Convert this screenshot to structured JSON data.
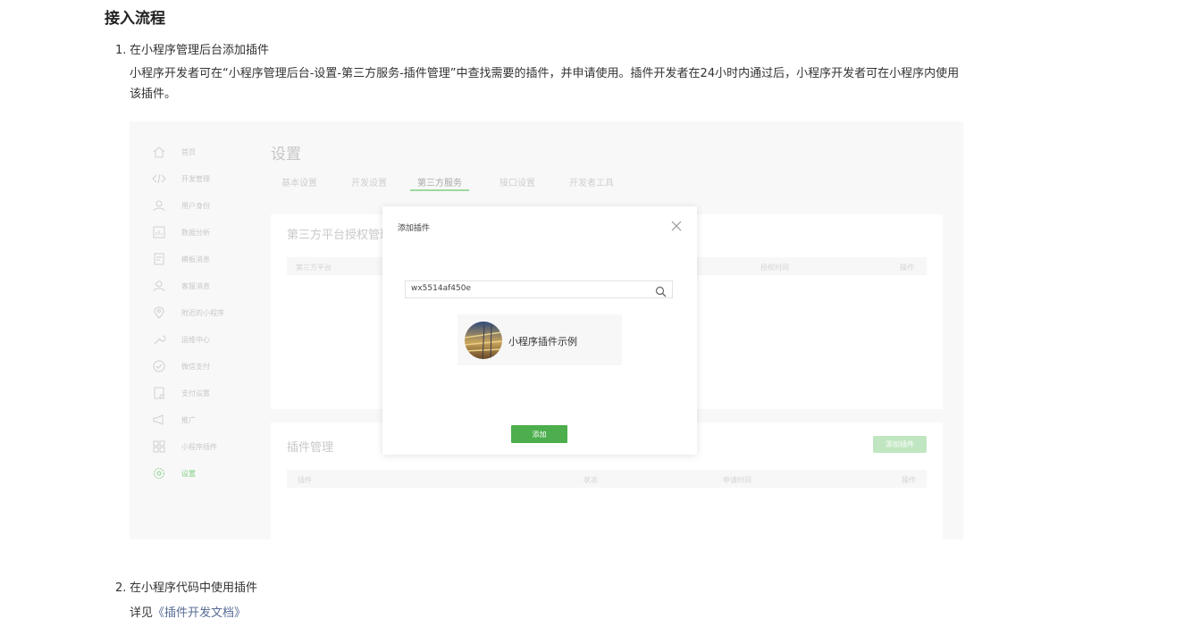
{
  "page": {
    "heading": "接入流程",
    "step1": {
      "number": "1.",
      "title": "在小程序管理后台添加插件"
    },
    "description": "小程序开发者可在“小程序管理后台-设置-第三方服务-插件管理”中查找需要的插件，并申请使用。插件开发者在24小时内通过后，小程序开发者可在小程序内使用该插件。",
    "step2": {
      "number": "2.",
      "title": "在小程序代码中使用插件"
    },
    "see_also": {
      "prefix": "详见",
      "link_text": "《插件开发文档》"
    },
    "link_color": "#576b95"
  },
  "screenshot": {
    "sidebar": [
      {
        "label": "首页",
        "icon": "home-icon"
      },
      {
        "label": "开发管理",
        "icon": "code-icon"
      },
      {
        "label": "用户身份",
        "icon": "user-icon"
      },
      {
        "label": "数据分析",
        "icon": "chart-icon"
      },
      {
        "label": "模板消息",
        "icon": "document-icon"
      },
      {
        "label": "客服消息",
        "icon": "support-icon"
      },
      {
        "label": "附近的小程序",
        "icon": "location-icon"
      },
      {
        "label": "运维中心",
        "icon": "wrench-icon"
      },
      {
        "label": "微信支付",
        "icon": "payment-icon"
      },
      {
        "label": "支付设置",
        "icon": "receipt-icon"
      },
      {
        "label": "推广",
        "icon": "megaphone-icon"
      },
      {
        "label": "小程序插件",
        "icon": "grid-icon"
      },
      {
        "label": "设置",
        "icon": "settings-icon",
        "active": true
      }
    ],
    "title": "设置",
    "tabs": [
      {
        "label": "基本设置"
      },
      {
        "label": "开发设置"
      },
      {
        "label": "第三方服务",
        "active": true
      },
      {
        "label": "接口设置"
      },
      {
        "label": "开发者工具"
      }
    ],
    "card1": {
      "title": "第三方平台授权管理",
      "columns": [
        "第三方平台",
        "授权时间",
        "操作"
      ]
    },
    "card2": {
      "title": "插件管理",
      "add_button": "添加插件",
      "columns": [
        "插件",
        "状态",
        "申请时间",
        "操作"
      ]
    },
    "modal": {
      "title": "添加插件",
      "search_value": "wx5514af450e",
      "result_name": "小程序插件示例",
      "add_button": "添加"
    },
    "accent_color": "#4cae4c"
  }
}
